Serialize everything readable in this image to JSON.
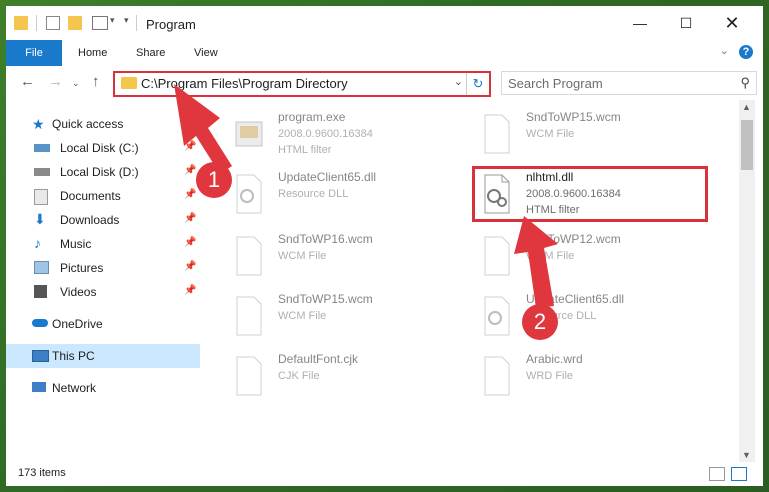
{
  "window": {
    "title": "Program",
    "min_icon": "minimize-icon",
    "max_icon": "maximize-icon",
    "close_icon": "close-icon"
  },
  "ribbon": {
    "tabs": [
      "File",
      "Home",
      "Share",
      "View"
    ],
    "help": "?"
  },
  "nav": {
    "address": "C:\\Program Files\\Program Directory",
    "search_placeholder": "Search Program"
  },
  "sidebar": {
    "items": [
      {
        "label": "Quick access",
        "icon": "star-icon",
        "pinned": false
      },
      {
        "label": "Local Disk (C:)",
        "icon": "drive-icon",
        "pinned": true
      },
      {
        "label": "Local Disk (D:)",
        "icon": "drive-icon",
        "pinned": true
      },
      {
        "label": "Documents",
        "icon": "documents-icon",
        "pinned": true
      },
      {
        "label": "Downloads",
        "icon": "download-icon",
        "pinned": true
      },
      {
        "label": "Music",
        "icon": "music-icon",
        "pinned": true
      },
      {
        "label": "Pictures",
        "icon": "pictures-icon",
        "pinned": true
      },
      {
        "label": "Videos",
        "icon": "videos-icon",
        "pinned": true
      },
      {
        "label": "OneDrive",
        "icon": "cloud-icon",
        "pinned": false
      },
      {
        "label": "This PC",
        "icon": "computer-icon",
        "pinned": false
      },
      {
        "label": "Network",
        "icon": "network-icon",
        "pinned": false
      }
    ]
  },
  "files": [
    {
      "name": "program.exe",
      "meta": "2008.0.9600.16384",
      "desc": "HTML filter"
    },
    {
      "name": "SndToWP15.wcm",
      "meta": "WCM File",
      "desc": ""
    },
    {
      "name": "UpdateClient65.dll",
      "meta": "Resource DLL",
      "desc": ""
    },
    {
      "name": "nlhtml.dll",
      "meta": "2008.0.9600.16384",
      "desc": "HTML filter"
    },
    {
      "name": "SndToWP16.wcm",
      "meta": "WCM File",
      "desc": ""
    },
    {
      "name": "SndToWP12.wcm",
      "meta": "WCM File",
      "desc": ""
    },
    {
      "name": "SndToWP15.wcm",
      "meta": "WCM File",
      "desc": ""
    },
    {
      "name": "UpdateClient65.dll",
      "meta": "Resource DLL",
      "desc": ""
    },
    {
      "name": "DefaultFont.cjk",
      "meta": "CJK File",
      "desc": ""
    },
    {
      "name": "Arabic.wrd",
      "meta": "WRD File",
      "desc": ""
    }
  ],
  "status": {
    "count": "173 items"
  },
  "callouts": [
    "1",
    "2"
  ],
  "colors": {
    "accent": "#1979ca",
    "highlight": "#d9323a",
    "selected": "#cce8ff"
  }
}
